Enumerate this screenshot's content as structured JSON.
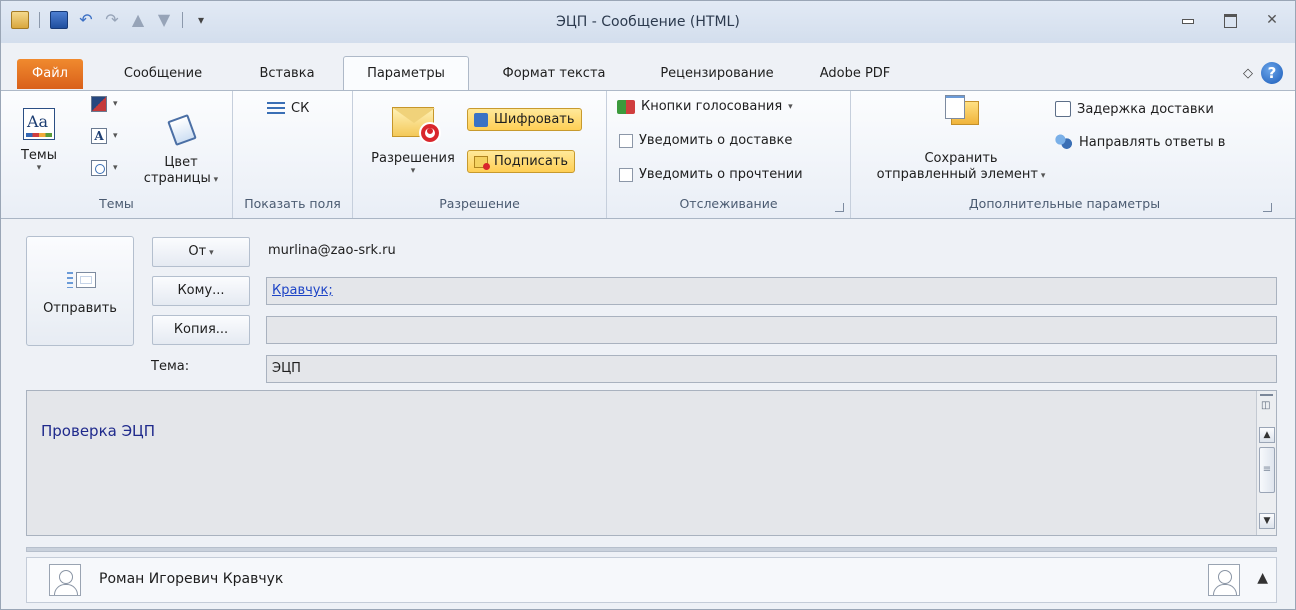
{
  "window": {
    "title": "ЭЦП - Сообщение (HTML)"
  },
  "tabs": [
    {
      "label": "Файл"
    },
    {
      "label": "Сообщение"
    },
    {
      "label": "Вставка"
    },
    {
      "label": "Параметры"
    },
    {
      "label": "Формат текста"
    },
    {
      "label": "Рецензирование"
    },
    {
      "label": "Adobe PDF"
    }
  ],
  "ribbon": {
    "themes": {
      "themes_label": "Темы",
      "page_color_label": "Цвет",
      "page_color_label2": "страницы",
      "group_label": "Темы"
    },
    "show_fields": {
      "bcc_label": "СК",
      "group_label": "Показать поля"
    },
    "permission": {
      "permission_label": "Разрешения",
      "encrypt_label": "Шифровать",
      "sign_label": "Подписать",
      "group_label": "Разрешение"
    },
    "tracking": {
      "voting_label": "Кнопки голосования",
      "delivery_label": "Уведомить о доставке",
      "read_label": "Уведомить о прочтении",
      "group_label": "Отслеживание"
    },
    "more_options": {
      "save_sent_label1": "Сохранить",
      "save_sent_label2": "отправленный элемент",
      "delay_label": "Задержка доставки",
      "direct_replies_label": "Направлять ответы в",
      "group_label": "Дополнительные параметры"
    }
  },
  "compose": {
    "send_label": "Отправить",
    "from_label": "От",
    "from_value": "murlina@zao-srk.ru",
    "to_label": "Кому...",
    "to_value": "Кравчук;",
    "cc_label": "Копия...",
    "cc_value": "",
    "subject_label": "Тема:",
    "subject_value": "ЭЦП",
    "body": "Проверка ЭЦП"
  },
  "people_pane": {
    "name": "Роман Игоревич Кравчук"
  },
  "colors": {
    "file_tab": "#e8762a",
    "highlight": "#ffd862",
    "link": "#1d44c6",
    "body_text": "#1f2a8c"
  }
}
